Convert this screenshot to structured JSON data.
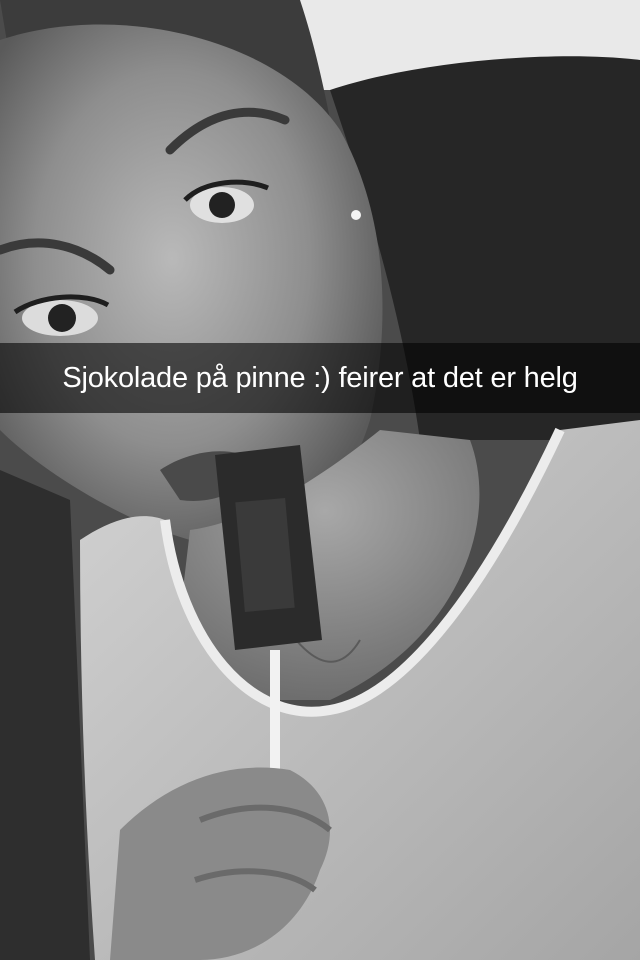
{
  "snap": {
    "caption": "Sjokolade på pinne :) feirer at det er helg",
    "filter": "black-and-white"
  }
}
